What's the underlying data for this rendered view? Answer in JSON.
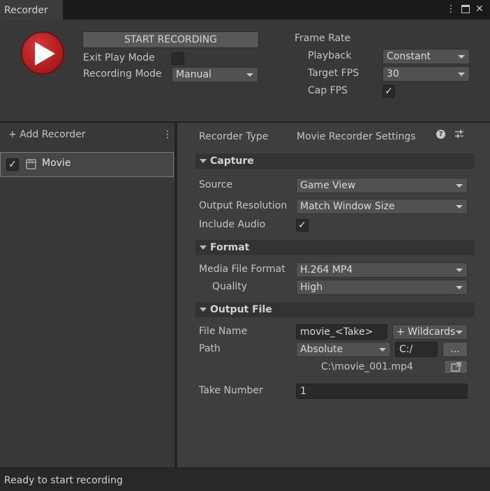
{
  "window": {
    "tab_title": "Recorder",
    "icons": [
      "kebab-menu-icon",
      "maximize-icon",
      "close-icon"
    ]
  },
  "controls": {
    "start_recording": "START RECORDING",
    "exit_play_mode_label": "Exit Play Mode",
    "exit_play_mode_checked": false,
    "recording_mode_label": "Recording Mode",
    "recording_mode_value": "Manual"
  },
  "frame_rate": {
    "header": "Frame Rate",
    "playback_label": "Playback",
    "playback_value": "Constant",
    "target_fps_label": "Target FPS",
    "target_fps_value": "30",
    "cap_fps_label": "Cap FPS",
    "cap_fps_checked": true,
    "check_glyph": "✓"
  },
  "recorder_list": {
    "add_label": "+ Add Recorder",
    "items": [
      {
        "label": "Movie",
        "enabled": true
      }
    ]
  },
  "settings": {
    "recorder_type_label": "Recorder Type",
    "recorder_type_value": "Movie Recorder Settings",
    "capture": {
      "header": "Capture",
      "source_label": "Source",
      "source_value": "Game View",
      "output_resolution_label": "Output Resolution",
      "output_resolution_value": "Match Window Size",
      "include_audio_label": "Include Audio",
      "include_audio_checked": true
    },
    "format": {
      "header": "Format",
      "media_file_format_label": "Media File Format",
      "media_file_format_value": "H.264 MP4",
      "quality_label": "Quality",
      "quality_value": "High"
    },
    "output_file": {
      "header": "Output File",
      "file_name_label": "File Name",
      "file_name_value": "movie_<Take>",
      "wildcards_label": "+ Wildcards",
      "path_label": "Path",
      "path_mode_value": "Absolute",
      "path_value": "C:/",
      "browse_label": "...",
      "resolved_path": "C:\\movie_001.mp4",
      "take_number_label": "Take Number",
      "take_number_value": "1"
    }
  },
  "status": {
    "text": "Ready to start recording"
  },
  "colors": {
    "accent_red": "#b51f1f",
    "panel_bg": "#383838",
    "inspector_bg": "#3e3e3e"
  }
}
